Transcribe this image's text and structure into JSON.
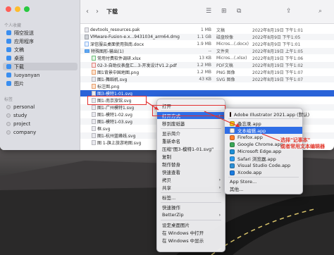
{
  "window": {
    "title": "下载",
    "back_glyph": "‹",
    "forward_glyph": "›",
    "toolbar_icons": [
      "☰",
      "⊞",
      "⧉",
      "⇪",
      "⌕"
    ]
  },
  "sidebar": {
    "section_personal": "个人收藏",
    "items": [
      "隔空投送",
      "应用程序",
      "文稿",
      "桌面",
      "下载",
      "luoyanyan",
      "图片"
    ],
    "section_tags": "标签",
    "tags": [
      "personal",
      "study",
      "project",
      "company"
    ]
  },
  "files": [
    {
      "name": "devtools_resources.pak",
      "size": "1 MB",
      "kind": "文稿",
      "date": "2022年8月19日 下午1:01",
      "icon": "doc"
    },
    {
      "name": "VMware-Fusion-e.x...9431034_arm64.dmg",
      "size": "1.1 GB",
      "kind": "磁盘映像",
      "date": "2022年8月9日 下午1:05",
      "icon": "dmg"
    },
    {
      "name": "深信服云桌面使用指南.docx",
      "size": "1.9 MB",
      "kind": "Micros...(.docx)",
      "date": "2022年8月9日 下午1:01",
      "icon": "blue"
    },
    {
      "name": "特殊图形-输出(1)",
      "size": "--",
      "kind": "文件夹",
      "date": "2022年8月19日 上午1:05",
      "icon": "folder"
    },
    {
      "name": "常用付费软件调研.xlsx",
      "size": "13 KB",
      "kind": "Micros...(.xlsx)",
      "date": "2022年8月19日 下午1:06",
      "icon": "green"
    },
    {
      "name": "02-3-自助仪表盘汇...3-开发设计V1.2.pdf",
      "size": "1.2 MB",
      "kind": "PDF文稿",
      "date": "2022年8月19日 下午1:02",
      "icon": "red"
    },
    {
      "name": "图1背景中国地图.png",
      "size": "1.2 MB",
      "kind": "PNG 图像",
      "date": "2022年8月19日 下午1:07",
      "icon": "img"
    },
    {
      "name": "图1-舞蹈机.svg",
      "size": "43 KB",
      "kind": "SVG 图像",
      "date": "2022年8月19日 下午1:07",
      "icon": "doc"
    },
    {
      "name": "标注图.png",
      "size": "",
      "kind": "",
      "date": "",
      "icon": "img"
    },
    {
      "name": "图3-模特1-01.svg",
      "size": "",
      "kind": "",
      "date": "",
      "icon": "doc"
    },
    {
      "name": "图1-南京旅馆.svg",
      "size": "",
      "kind": "",
      "date": "",
      "icon": "doc"
    },
    {
      "name": "图1-广州模特1.svg",
      "size": "",
      "kind": "",
      "date": "",
      "icon": "doc"
    },
    {
      "name": "图1-模特1-02.svg",
      "size": "",
      "kind": "",
      "date": "",
      "icon": "doc"
    },
    {
      "name": "图1-模特1-03.svg",
      "size": "",
      "kind": "",
      "date": "",
      "icon": "doc"
    },
    {
      "name": "框.svg",
      "size": "",
      "kind": "",
      "date": "",
      "icon": "doc"
    },
    {
      "name": "图1-杭州蓝峰线.svg",
      "size": "",
      "kind": "",
      "date": "",
      "icon": "doc"
    },
    {
      "name": "图 1-旗上旅游地图.svg",
      "size": "",
      "kind": "",
      "date": "",
      "icon": "doc"
    }
  ],
  "context_menu": {
    "items": [
      "打开",
      "打开方式",
      "移到废纸篓",
      "显示简介",
      "重新命名",
      "压缩\"图3-模特1-01.svg\"",
      "复制",
      "制作替身",
      "快速查看",
      "拷贝",
      "共享",
      "标签...",
      "快速操作",
      "BetterZip",
      "设定桌面图片",
      "在 Windows 中打开",
      "在 Windows 中显示"
    ],
    "arrow": "›"
  },
  "open_with": {
    "items": [
      {
        "label": "Adobe Illustrator 2021.app (默认)",
        "color": "#2b1200"
      },
      {
        "label": "备忘录.app",
        "color": "#f5c518"
      },
      {
        "label": "文本编辑.app",
        "color": "#f0f0f0"
      },
      {
        "label": "Firefox.app",
        "color": "#ff7b2a"
      },
      {
        "label": "Google Chrome.app",
        "color": "#3aa757"
      },
      {
        "label": "Microsoft Edge.app",
        "color": "#1e8fd6"
      },
      {
        "label": "Safari 浏览器.app",
        "color": "#2c9cf0"
      },
      {
        "label": "Visual Studio Code.app",
        "color": "#2d8fd5"
      },
      {
        "label": "Xcode.app",
        "color": "#1c7ce0"
      },
      {
        "label": "App Store...",
        "color": ""
      },
      {
        "label": "其他...",
        "color": ""
      }
    ]
  },
  "annotation": {
    "line1": "选择\"记事本\"",
    "line2": "或者常用文本编辑器"
  },
  "colors": {
    "selection": "#2a63d8",
    "highlight": "#2f6ee6",
    "annotation": "#e23b2f"
  }
}
